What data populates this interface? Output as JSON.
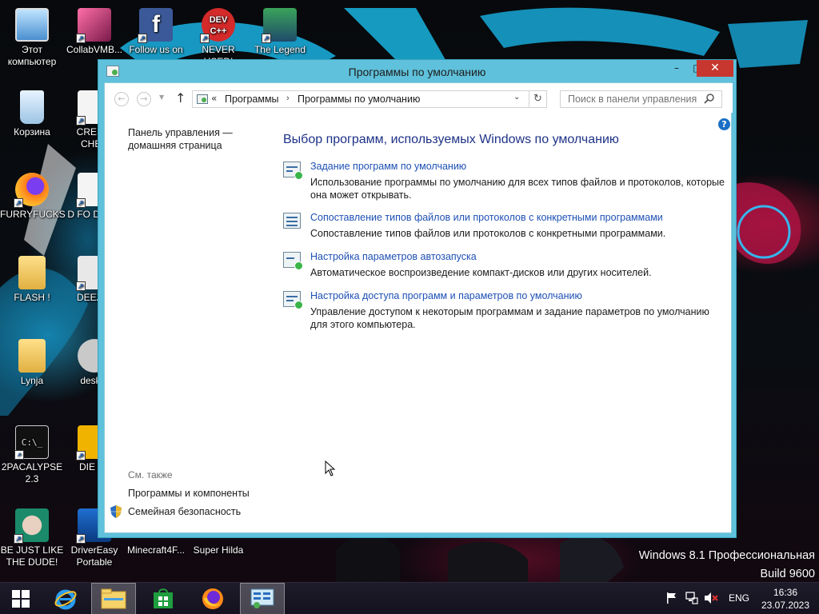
{
  "desktop": {
    "icons": [
      {
        "label": "Этот компьютер",
        "icon": "computer-icon"
      },
      {
        "label": "CollabVMB...",
        "icon": "app-icon"
      },
      {
        "label": "Follow us on",
        "icon": "facebook-icon"
      },
      {
        "label": "NEVER USED!",
        "icon": "devcpp-icon"
      },
      {
        "label": "The Legend",
        "icon": "game-icon"
      },
      {
        "label": "Корзина",
        "icon": "recycle-bin-icon"
      },
      {
        "label": "CREDIT CHEC",
        "icon": "shortcut-icon"
      },
      {
        "label": "FURRYFUCKS",
        "icon": "firefox-icon"
      },
      {
        "label": "D FO DUME",
        "icon": "shortcut-icon"
      },
      {
        "label": "FLASH !",
        "icon": "folder-icon"
      },
      {
        "label": "DEEZ N",
        "icon": "shortcut-icon"
      },
      {
        "label": "Lynja",
        "icon": "folder-icon"
      },
      {
        "label": "deskto",
        "icon": "settings-icon"
      },
      {
        "label": "2PACALYPSE 2.3",
        "icon": "cmd-icon"
      },
      {
        "label": "DIE PL",
        "icon": "game-icon"
      },
      {
        "label": "BE JUST LIKE THE DUDE!",
        "icon": "app-icon"
      },
      {
        "label": "DriverEasy Portable",
        "icon": "drivereasy-icon"
      },
      {
        "label": "Minecraft4F...",
        "icon": "shortcut-icon"
      },
      {
        "label": "Super Hilda",
        "icon": "shortcut-icon"
      }
    ],
    "watermark": {
      "line1": "Windows 8.1 Профессиональная",
      "line2": "Build 9600"
    }
  },
  "window": {
    "title": "Программы по умолчанию",
    "minimize": "–",
    "maximize": "□",
    "close": "✕"
  },
  "navbar": {
    "back": "←",
    "forward": "→",
    "up": "↑",
    "chevron": "«",
    "breadcrumbs": [
      "Программы",
      "Программы по умолчанию"
    ],
    "separator": "›",
    "dropdown": "⌄",
    "refresh": "↻",
    "search_placeholder": "Поиск в панели управления"
  },
  "left_pane": {
    "home_link": "Панель управления — домашняя страница",
    "see_also": "См. также",
    "links": [
      "Программы и компоненты",
      "Семейная безопасность"
    ]
  },
  "main": {
    "heading": "Выбор программ, используемых Windows по умолчанию",
    "tasks": [
      {
        "link": "Задание программ по умолчанию",
        "desc": "Использование программы по умолчанию для всех типов файлов и протоколов, которые она может открывать."
      },
      {
        "link": "Сопоставление типов файлов или протоколов с конкретными программами",
        "desc": "Сопоставление типов файлов или протоколов с конкретными программами."
      },
      {
        "link": "Настройка параметров автозапуска",
        "desc": "Автоматическое воспроизведение компакт-дисков или других носителей."
      },
      {
        "link": "Настройка доступа программ и параметров по умолчанию",
        "desc": "Управление доступом к некоторым программам и задание параметров по умолчанию для этого компьютера."
      }
    ]
  },
  "taskbar": {
    "pinned": [
      "start-icon",
      "internet-explorer-icon",
      "file-explorer-icon",
      "store-icon",
      "firefox-icon",
      "control-panel-icon"
    ],
    "language": "ENG",
    "time": "16:36",
    "date": "23.07.2023"
  },
  "colors": {
    "window_frame": "#5fc1db",
    "close_button": "#c7372f",
    "link": "#1e50b4",
    "heading": "#1e3287"
  }
}
